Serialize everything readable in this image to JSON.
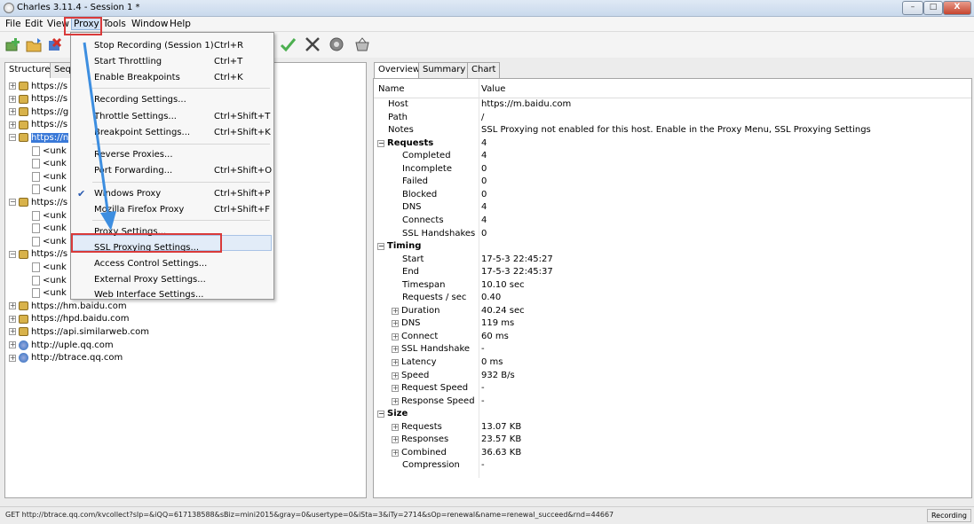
{
  "window": {
    "title": "Charles 3.11.4 - Session 1 *",
    "min": "–",
    "max": "□",
    "close": "X"
  },
  "menubar": [
    "File",
    "Edit",
    "View",
    "Proxy",
    "Tools",
    "Window",
    "Help"
  ],
  "left_tabs": [
    "Structure",
    "Seq"
  ],
  "tree": [
    {
      "label": "https://s",
      "icon": "lock",
      "exp": "+"
    },
    {
      "label": "https://s",
      "icon": "lock",
      "exp": "+"
    },
    {
      "label": "https://g",
      "icon": "lock",
      "exp": "+"
    },
    {
      "label": "https://s",
      "icon": "lock",
      "exp": "+"
    },
    {
      "label": "https://n",
      "icon": "lock",
      "exp": "−",
      "selected": true
    },
    {
      "label": "<unk",
      "icon": "doc",
      "indent": 1
    },
    {
      "label": "<unk",
      "icon": "doc",
      "indent": 1
    },
    {
      "label": "<unk",
      "icon": "doc",
      "indent": 1
    },
    {
      "label": "<unk",
      "icon": "doc",
      "indent": 1
    },
    {
      "label": "https://s",
      "icon": "lock",
      "exp": "−"
    },
    {
      "label": "<unk",
      "icon": "doc",
      "indent": 1
    },
    {
      "label": "<unk",
      "icon": "doc",
      "indent": 1
    },
    {
      "label": "<unk",
      "icon": "doc",
      "indent": 1
    },
    {
      "label": "https://s",
      "icon": "lock",
      "exp": "−"
    },
    {
      "label": "<unk",
      "icon": "doc",
      "indent": 1
    },
    {
      "label": "<unk",
      "icon": "doc",
      "indent": 1
    },
    {
      "label": "<unk",
      "icon": "doc",
      "indent": 1
    },
    {
      "label": "https://hm.baidu.com",
      "icon": "lock",
      "exp": "+"
    },
    {
      "label": "https://hpd.baidu.com",
      "icon": "lock",
      "exp": "+"
    },
    {
      "label": "https://api.similarweb.com",
      "icon": "lock",
      "exp": "+"
    },
    {
      "label": "http://uple.qq.com",
      "icon": "globe",
      "exp": "+"
    },
    {
      "label": "http://btrace.qq.com",
      "icon": "globe",
      "exp": "+"
    }
  ],
  "right_tabs": [
    "Overview",
    "Summary",
    "Chart"
  ],
  "prop_header": {
    "name": "Name",
    "value": "Value"
  },
  "props": [
    {
      "n": "Host",
      "v": "https://m.baidu.com",
      "l": 1
    },
    {
      "n": "Path",
      "v": "/",
      "l": 1
    },
    {
      "n": "Notes",
      "v": "SSL Proxying not enabled for this host. Enable in the Proxy Menu, SSL Proxying Settings",
      "l": 1
    },
    {
      "n": "Requests",
      "v": "4",
      "l": 0,
      "b": true,
      "e": "−"
    },
    {
      "n": "Completed",
      "v": "4",
      "l": 2
    },
    {
      "n": "Incomplete",
      "v": "0",
      "l": 2
    },
    {
      "n": "Failed",
      "v": "0",
      "l": 2
    },
    {
      "n": "Blocked",
      "v": "0",
      "l": 2
    },
    {
      "n": "DNS",
      "v": "4",
      "l": 2
    },
    {
      "n": "Connects",
      "v": "4",
      "l": 2
    },
    {
      "n": "SSL Handshakes",
      "v": "0",
      "l": 2
    },
    {
      "n": "Timing",
      "v": "",
      "l": 0,
      "b": true,
      "e": "−"
    },
    {
      "n": "Start",
      "v": "17-5-3 22:45:27",
      "l": 2
    },
    {
      "n": "End",
      "v": "17-5-3 22:45:37",
      "l": 2
    },
    {
      "n": "Timespan",
      "v": "10.10 sec",
      "l": 2
    },
    {
      "n": "Requests / sec",
      "v": "0.40",
      "l": 2
    },
    {
      "n": "Duration",
      "v": "40.24 sec",
      "l": 2,
      "e": "+"
    },
    {
      "n": "DNS",
      "v": "119 ms",
      "l": 2,
      "e": "+"
    },
    {
      "n": "Connect",
      "v": "60 ms",
      "l": 2,
      "e": "+"
    },
    {
      "n": "SSL Handshake",
      "v": "-",
      "l": 2,
      "e": "+"
    },
    {
      "n": "Latency",
      "v": "0 ms",
      "l": 2,
      "e": "+"
    },
    {
      "n": "Speed",
      "v": "932 B/s",
      "l": 2,
      "e": "+"
    },
    {
      "n": "Request Speed",
      "v": "-",
      "l": 2,
      "e": "+"
    },
    {
      "n": "Response Speed",
      "v": "-",
      "l": 2,
      "e": "+"
    },
    {
      "n": "Size",
      "v": "",
      "l": 0,
      "b": true,
      "e": "−"
    },
    {
      "n": "Requests",
      "v": "13.07 KB",
      "l": 2,
      "e": "+"
    },
    {
      "n": "Responses",
      "v": "23.57 KB",
      "l": 2,
      "e": "+"
    },
    {
      "n": "Combined",
      "v": "36.63 KB",
      "l": 2,
      "e": "+"
    },
    {
      "n": "Compression",
      "v": "-",
      "l": 2
    }
  ],
  "proxy_menu": [
    {
      "label": "Stop Recording (Session 1)",
      "shortcut": "Ctrl+R"
    },
    {
      "label": "Start Throttling",
      "shortcut": "Ctrl+T"
    },
    {
      "label": "Enable Breakpoints",
      "shortcut": "Ctrl+K"
    },
    {
      "sep": true
    },
    {
      "label": "Recording Settings...",
      "shortcut": ""
    },
    {
      "label": "Throttle Settings...",
      "shortcut": "Ctrl+Shift+T"
    },
    {
      "label": "Breakpoint Settings...",
      "shortcut": "Ctrl+Shift+K"
    },
    {
      "sep": true
    },
    {
      "label": "Reverse Proxies...",
      "shortcut": ""
    },
    {
      "label": "Port Forwarding...",
      "shortcut": "Ctrl+Shift+O"
    },
    {
      "sep": true
    },
    {
      "label": "Windows Proxy",
      "shortcut": "Ctrl+Shift+P",
      "checked": true
    },
    {
      "label": "Mozilla Firefox Proxy",
      "shortcut": "Ctrl+Shift+F"
    },
    {
      "sep": true
    },
    {
      "label": "Proxy Settings...",
      "shortcut": ""
    },
    {
      "label": "SSL Proxying Settings...",
      "shortcut": "",
      "highlighted": true
    },
    {
      "label": "Access Control Settings...",
      "shortcut": ""
    },
    {
      "label": "External Proxy Settings...",
      "shortcut": ""
    },
    {
      "label": "Web Interface Settings...",
      "shortcut": ""
    }
  ],
  "status": {
    "text": "GET http://btrace.qq.com/kvcollect?sIp=&iQQ=617138588&sBiz=mini2015&gray=0&usertype=0&iSta=3&iTy=2714&sOp=renewal&name=renewal_succeed&rnd=44667",
    "recording": "Recording"
  },
  "colors": {
    "highlight_red": "#d93a3a",
    "selection_blue": "#3a79d8",
    "arrow_blue": "#3d8ee0"
  }
}
